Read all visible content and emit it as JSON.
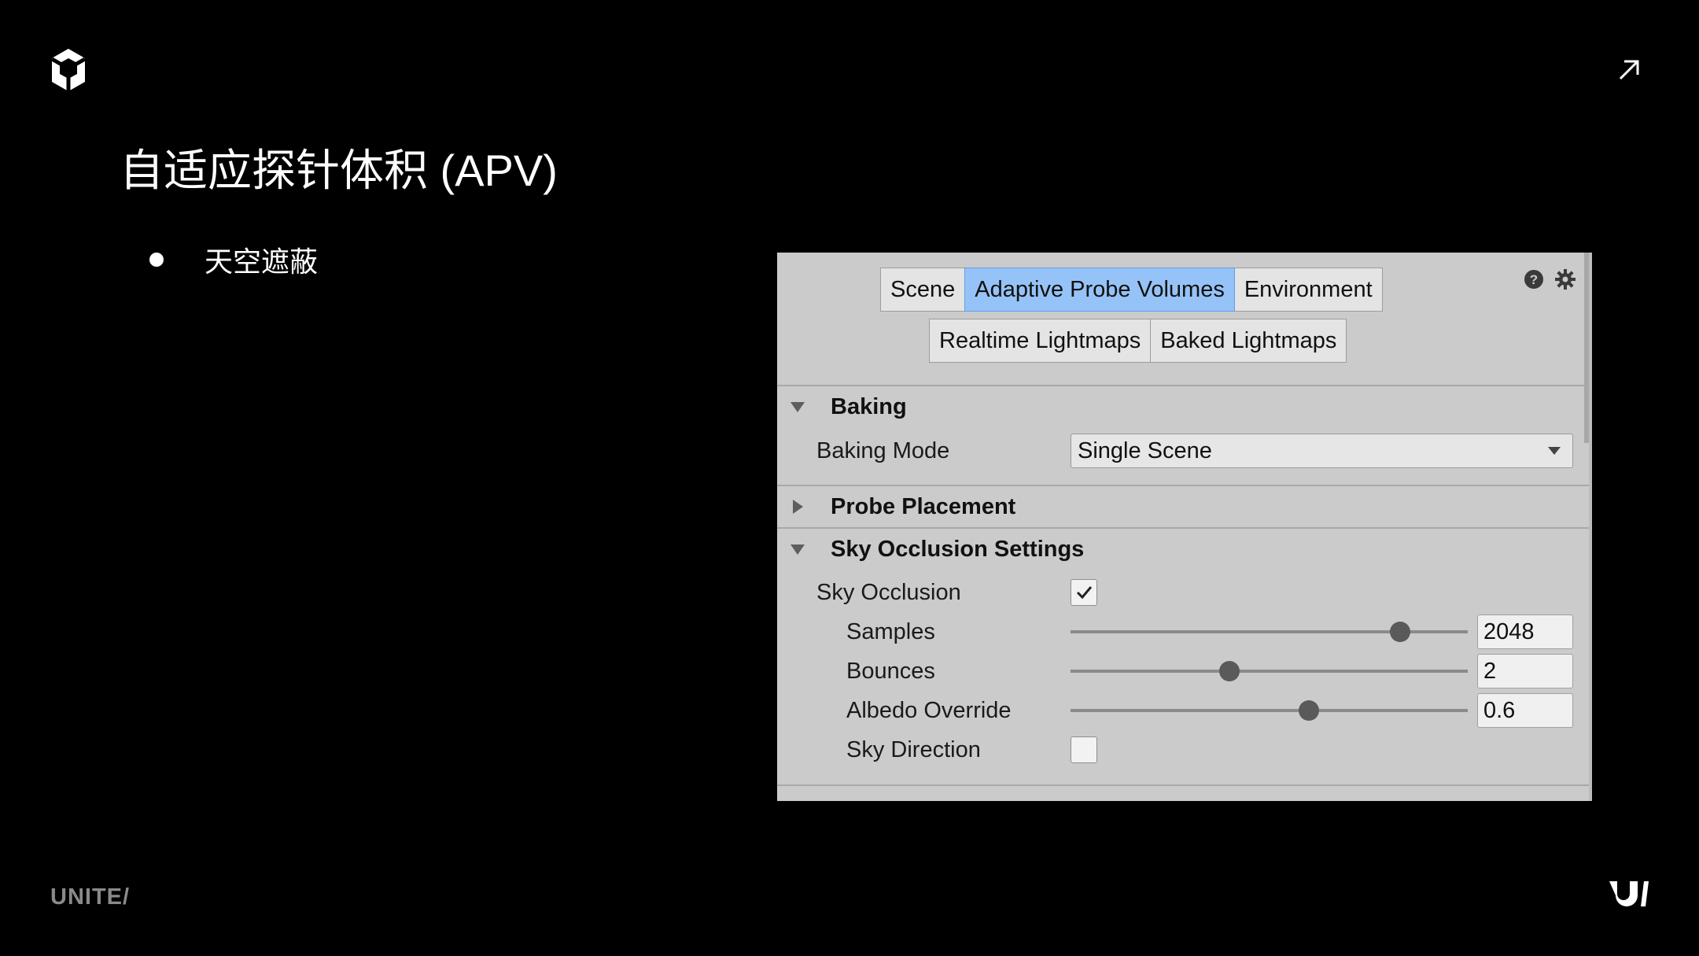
{
  "slide": {
    "title": "自适应探针体积 (APV)",
    "bullets": [
      "天空遮蔽"
    ],
    "footer_brand": "UNITE/"
  },
  "panel": {
    "tabs_row1": [
      "Scene",
      "Adaptive Probe Volumes",
      "Environment"
    ],
    "tabs_row2": [
      "Realtime Lightmaps",
      "Baked Lightmaps"
    ],
    "active_tab": "Adaptive Probe Volumes",
    "sections": {
      "baking": {
        "title": "Baking",
        "expanded": true,
        "baking_mode_label": "Baking Mode",
        "baking_mode_value": "Single Scene"
      },
      "probe_placement": {
        "title": "Probe Placement",
        "expanded": false
      },
      "sky_occlusion": {
        "title": "Sky Occlusion Settings",
        "expanded": true,
        "sky_occlusion_label": "Sky Occlusion",
        "sky_occlusion_checked": true,
        "samples_label": "Samples",
        "samples_value": "2048",
        "samples_slider_pct": 83,
        "bounces_label": "Bounces",
        "bounces_value": "2",
        "bounces_slider_pct": 40,
        "albedo_label": "Albedo Override",
        "albedo_value": "0.6",
        "albedo_slider_pct": 60,
        "sky_direction_label": "Sky Direction",
        "sky_direction_checked": false
      }
    },
    "colors": {
      "active_tab": "#96c3f7",
      "panel_bg": "#cbcbcb"
    }
  }
}
